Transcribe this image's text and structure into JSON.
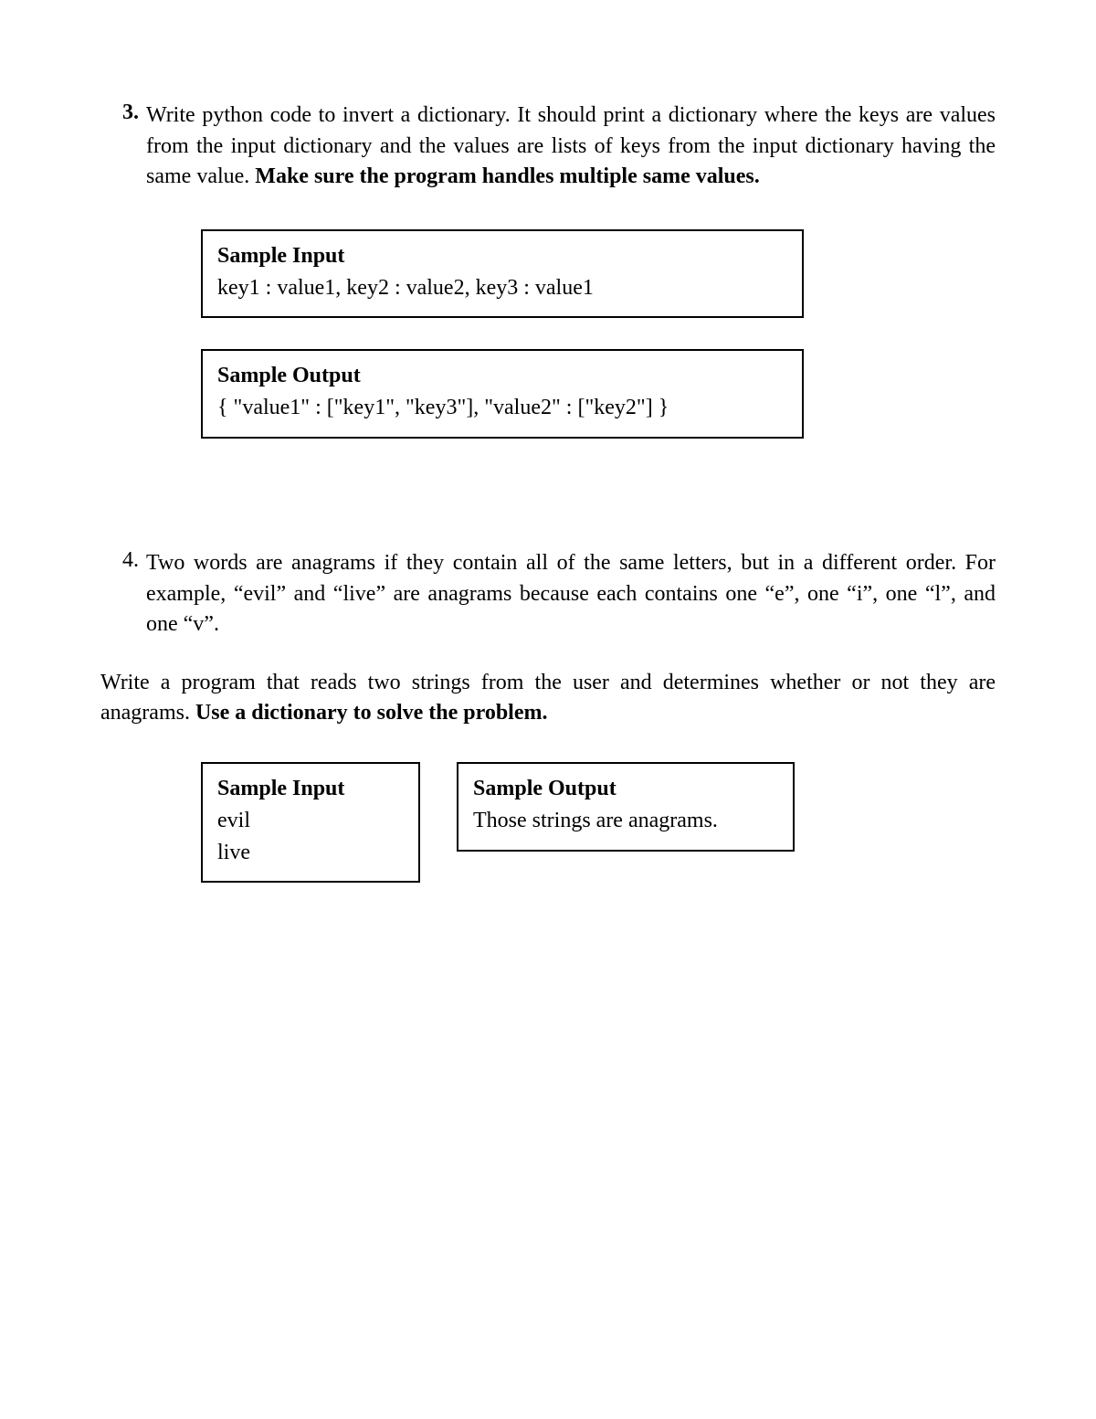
{
  "q3": {
    "number": "3.",
    "text_plain": "Write python code to invert a dictionary. It should print a dictionary where the keys are values from the input dictionary and the values are lists of keys from the input dictionary having the same value. ",
    "text_bold": "Make sure the program handles multiple same values.",
    "sample_input_label": "Sample Input",
    "sample_input_text": "key1 : value1, key2 : value2, key3 : value1",
    "sample_output_label": "Sample Output",
    "sample_output_text": "{ \"value1\" : [\"key1\", \"key3\"], \"value2\" : [\"key2\"] }"
  },
  "q4": {
    "number": "4.",
    "text": "Two words are anagrams if they contain all of the same letters, but in a different order. For example, “evil” and “live” are anagrams because each contains one “e”, one “i”, one “l”, and one “v”.",
    "followup_plain": "Write a program that reads two strings from the user and determines whether or not they are anagrams. ",
    "followup_bold": "Use a dictionary to solve the problem.",
    "sample_input_label": "Sample Input",
    "sample_input_line1": "evil",
    "sample_input_line2": "live",
    "sample_output_label": "Sample Output",
    "sample_output_text": "Those strings are anagrams."
  }
}
